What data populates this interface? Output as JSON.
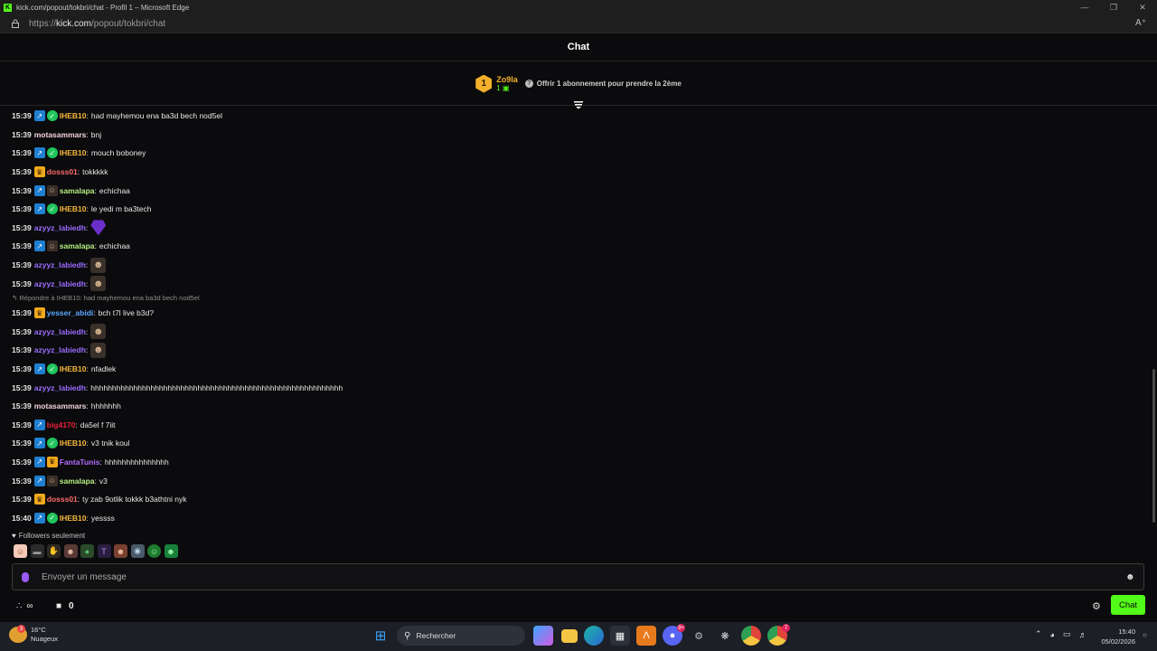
{
  "window": {
    "title": "kick.com/popout/tokbri/chat - Profil 1 – Microsoft Edge",
    "url_prefix": "https://",
    "url_domain": "kick.com",
    "url_path": "/popout/tokbri/chat"
  },
  "chat": {
    "header": "Chat",
    "pinned": {
      "rank": "1",
      "user": "Zo9la",
      "count": "1",
      "text": "Offrir 1 abonnement pour prendre la 2ème"
    },
    "messages": [
      {
        "ts": "15:39",
        "badges": [
          "sub",
          "verified"
        ],
        "user": "IHEB10",
        "color": "#f6b73c",
        "text": "had mayhemou ena ba3d bech nod5el"
      },
      {
        "ts": "15:39",
        "badges": [],
        "user": "motasammars",
        "color": "#f3d2dc",
        "text": "bnj"
      },
      {
        "ts": "15:39",
        "badges": [
          "sub",
          "verified"
        ],
        "user": "IHEB10",
        "color": "#f6b73c",
        "text": "mouch boboney"
      },
      {
        "ts": "15:39",
        "badges": [
          "crown"
        ],
        "user": "dosss01",
        "color": "#ff6b6b",
        "text": "tokkkkk"
      },
      {
        "ts": "15:39",
        "badges": [
          "sub",
          "avatar"
        ],
        "user": "samalapa",
        "color": "#b6f080",
        "text": "echichaa"
      },
      {
        "ts": "15:39",
        "badges": [
          "sub",
          "verified"
        ],
        "user": "IHEB10",
        "color": "#f6b73c",
        "text": "le yedi m ba3tech"
      },
      {
        "ts": "15:39",
        "badges": [],
        "user": "azyyz_labiedh",
        "color": "#9b6cff",
        "text": "",
        "emote": "gem"
      },
      {
        "ts": "15:39",
        "badges": [
          "sub",
          "avatar"
        ],
        "user": "samalapa",
        "color": "#b6f080",
        "text": "echichaa"
      },
      {
        "ts": "15:39",
        "badges": [],
        "user": "azyyz_labiedh",
        "color": "#9b6cff",
        "text": "",
        "emote": "face"
      },
      {
        "ts": "15:39",
        "badges": [],
        "user": "azyyz_labiedh",
        "color": "#9b6cff",
        "text": "",
        "emote": "face"
      },
      {
        "reply": "Répondre à IHEB10: had mayhemou ena ba3d bech nod5el",
        "ts": "15:39",
        "badges": [
          "crown"
        ],
        "user": "yesser_abidi",
        "color": "#5aa9ff",
        "text": "bch t7l live b3d?"
      },
      {
        "ts": "15:39",
        "badges": [],
        "user": "azyyz_labiedh",
        "color": "#9b6cff",
        "text": "",
        "emote": "face"
      },
      {
        "ts": "15:39",
        "badges": [],
        "user": "azyyz_labiedh",
        "color": "#9b6cff",
        "text": "",
        "emote": "face"
      },
      {
        "ts": "15:39",
        "badges": [
          "sub",
          "verified"
        ],
        "user": "IHEB10",
        "color": "#f6b73c",
        "text": "nfadlek"
      },
      {
        "ts": "15:39",
        "badges": [],
        "user": "azyyz_labiedh",
        "color": "#9b6cff",
        "text": "hhhhhhhhhhhhhhhhhhhhhhhhhhhhhhhhhhhhhhhhhhhhhhhhhhhhhhhhhhh"
      },
      {
        "ts": "15:39",
        "badges": [],
        "user": "motasammars",
        "color": "#f3d2dc",
        "text": "hhhhhhh"
      },
      {
        "ts": "15:39",
        "badges": [
          "sub"
        ],
        "user": "big4170",
        "color": "#e8213a",
        "text": "da5el f 7iit"
      },
      {
        "ts": "15:39",
        "badges": [
          "sub",
          "verified"
        ],
        "user": "IHEB10",
        "color": "#f6b73c",
        "text": "v3 tnik koul"
      },
      {
        "ts": "15:39",
        "badges": [
          "sub",
          "crown"
        ],
        "user": "FantaTunis",
        "color": "#b56cff",
        "text": "hhhhhhhhhhhhhhh"
      },
      {
        "ts": "15:39",
        "badges": [
          "sub",
          "avatar"
        ],
        "user": "samalapa",
        "color": "#b6f080",
        "text": "v3"
      },
      {
        "ts": "15:39",
        "badges": [
          "crown"
        ],
        "user": "dosss01",
        "color": "#ff6b6b",
        "text": "ty zab 9otlik tokkk b3athtni nyk"
      },
      {
        "ts": "15:40",
        "badges": [
          "sub",
          "verified"
        ],
        "user": "IHEB10",
        "color": "#f6b73c",
        "text": "yessss"
      }
    ],
    "followers_only": "Followers seulement",
    "input_placeholder": "Envoyer un message",
    "store_count": "0",
    "chat_button": "Chat"
  },
  "taskbar": {
    "temp": "16°C",
    "weather": "Nuageux",
    "weather_badge": "3",
    "search": "Rechercher",
    "discord_badge": "9+",
    "chrome_badge": "7",
    "time": "15:40",
    "date": "05/02/2026"
  }
}
